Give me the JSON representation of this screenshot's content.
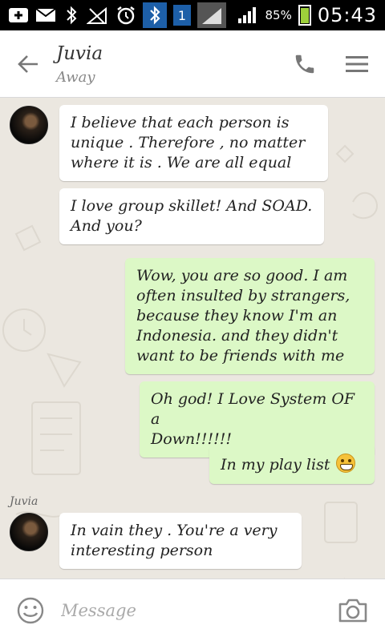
{
  "status_bar": {
    "battery_text": "85%",
    "time": "05:43",
    "badge": "1",
    "icons": [
      "add-icon",
      "mail-icon",
      "bluetooth-icon",
      "no-signal-icon",
      "alarm-icon",
      "bluetooth-active-icon",
      "sim-badge",
      "signal-icon",
      "signal-bars-icon",
      "battery-icon"
    ]
  },
  "header": {
    "contact_name": "Juvia",
    "contact_status": "Away",
    "icons": [
      "back-arrow-icon",
      "phone-icon",
      "menu-icon"
    ]
  },
  "messages": [
    {
      "direction": "in",
      "text": "I believe that each person is\nunique . Therefore , no matter\nwhere it is . We are all equal"
    },
    {
      "direction": "in",
      "text": "I love group skillet! And SOAD.\nAnd you?"
    },
    {
      "direction": "out",
      "text": "Wow, you are so good. I am\noften insulted by strangers,\nbecause they know I'm an\nIndonesia. and they didn't\nwant to be friends with me"
    },
    {
      "direction": "out",
      "text": "Oh god! I Love System OF a\nDown!!!!!!"
    },
    {
      "direction": "out",
      "text": "In my play list",
      "emoji": "grinning-face-emoji"
    },
    {
      "direction": "in",
      "sender": "Juvia",
      "text": "In vain they . You're a very\ninteresting person"
    }
  ],
  "input": {
    "placeholder": "Message",
    "value": "",
    "icons": [
      "emoji-icon",
      "camera-icon"
    ]
  },
  "colors": {
    "incoming_bubble": "#ffffff",
    "outgoing_bubble": "#dcf8c6",
    "chat_background": "#ebe7e0",
    "battery_fill": "#9ed13b",
    "bluetooth_highlight": "#1d5fa8"
  }
}
